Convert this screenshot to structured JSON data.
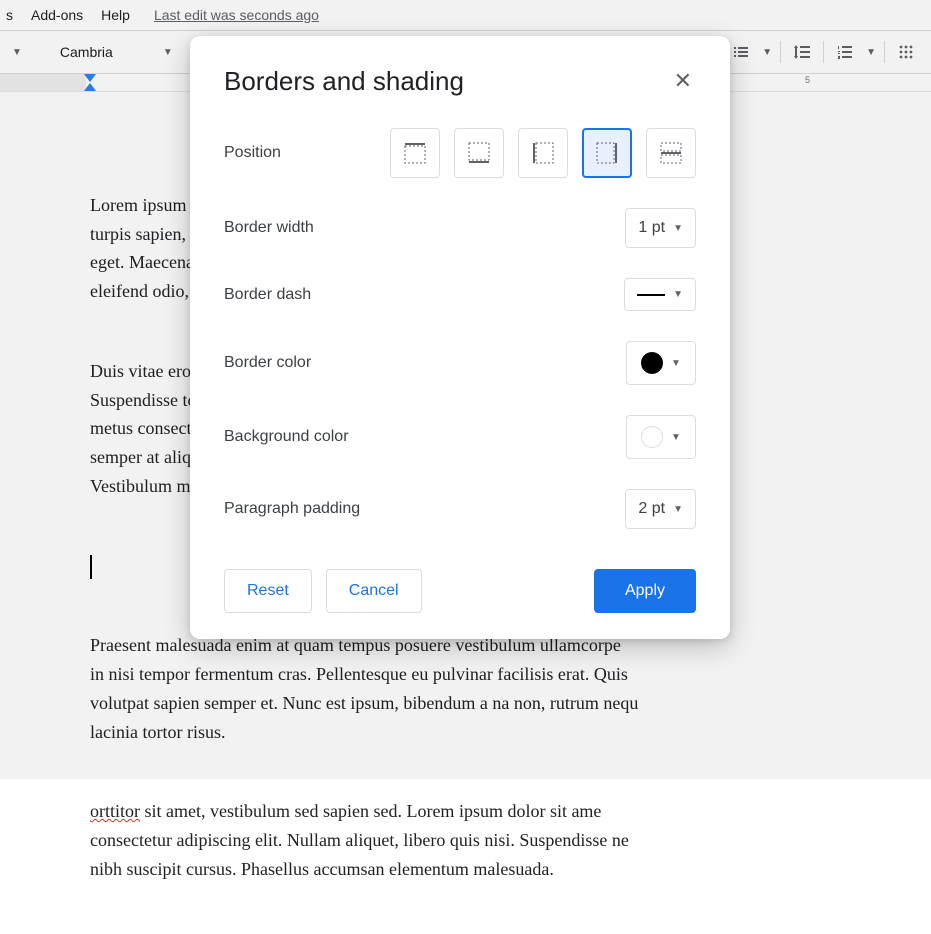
{
  "menubar": {
    "items": [
      "s",
      "Add-ons",
      "Help"
    ],
    "last_edit": "Last edit was seconds ago"
  },
  "toolbar": {
    "font": "Cambria"
  },
  "ruler": {
    "number": "5"
  },
  "document": {
    "p1": "Lorem ipsum dolor sit amet, consectetur adipiscing elit mauris. Suspendisse d\nturpis sapien, lacinia consectetur dolor eget, pharetra diam, eu mollis urna o\neget. Maecenas ac nisi luctus, tincidunt nunc nunc nec faucibus urna est. Se\neleifend odio, in hendrerit elit eget lacus.",
    "p2": "Duis vitae eros ante. Nullam tincidunt velit libero, scelerisque nec maximus d\nSuspendisse tortor purus, maximus nec massa id massa. Proin venenatis lorem\nmetus consectetur, vitae ullamcorper risus nisl elementum. Nullam lectus i\nsemper at aliquet laoreet justo, fringilla nec convallis ante. Pellentesque eg\nVestibulum mauris.",
    "p3": "Praesent malesuada enim at quam tempus posuere vestibulum ullamcorpe\nin nisi tempor fermentum cras. Pellentesque eu pulvinar facilisis erat. Quis\nvolutpat sapien semper et. Nunc est ipsum, bibendum a na non, rutrum nequ\nlacinia tortor risus.",
    "p4_pre": "orttitor",
    "p4_post": " sit amet, vestibulum sed sapien sed. Lorem ipsum dolor sit ame\nconsectetur adipiscing elit. Nullam aliquet, libero quis nisi. Suspendisse ne\nnibh suscipit cursus. Phasellus accumsan elementum malesuada."
  },
  "dialog": {
    "title": "Borders and shading",
    "labels": {
      "position": "Position",
      "border_width": "Border width",
      "border_dash": "Border dash",
      "border_color": "Border color",
      "background_color": "Background color",
      "paragraph_padding": "Paragraph padding"
    },
    "values": {
      "border_width": "1 pt",
      "paragraph_padding": "2 pt"
    },
    "buttons": {
      "reset": "Reset",
      "cancel": "Cancel",
      "apply": "Apply"
    }
  }
}
